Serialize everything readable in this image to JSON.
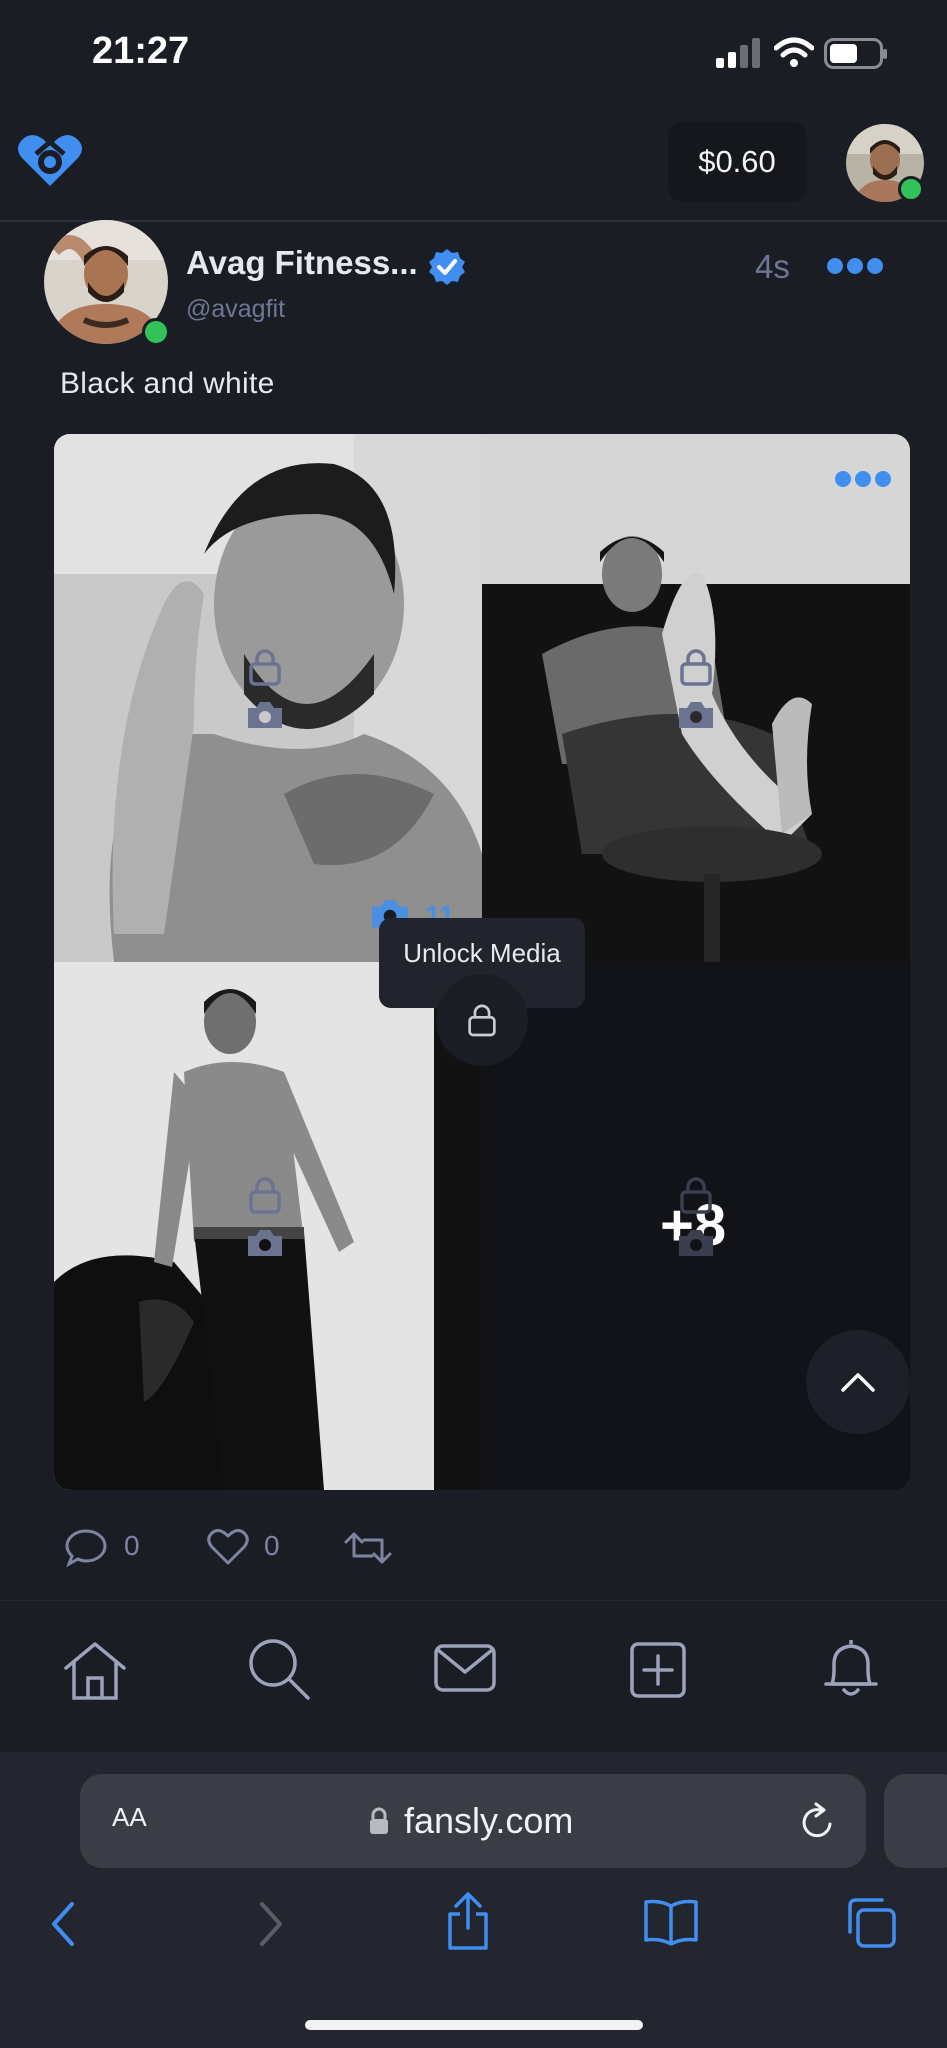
{
  "status_bar": {
    "time": "21:27"
  },
  "header": {
    "balance": "$0.60",
    "accent_color": "#3f8ef0",
    "online_color": "#33c15a"
  },
  "post": {
    "author_name": "Avag Fitness...",
    "author_handle": "@avagfit",
    "time_ago": "4s",
    "caption": "Black and white",
    "media_count": "11",
    "extra_media": "+8",
    "unlock_label": "Unlock Media",
    "comments": "0",
    "likes": "0"
  },
  "browser": {
    "text_size_label": "AA",
    "url": "fansly.com"
  },
  "icons": [
    "fansly-logo-icon",
    "verified-icon",
    "more-icon",
    "lock-icon",
    "camera-icon",
    "comment-icon",
    "heart-icon",
    "repost-icon",
    "home-icon",
    "search-icon",
    "messages-icon",
    "create-post-icon",
    "bell-icon",
    "reload-icon",
    "back-icon",
    "forward-icon",
    "share-icon",
    "bookmarks-icon",
    "tabs-icon",
    "chevron-up-icon"
  ]
}
